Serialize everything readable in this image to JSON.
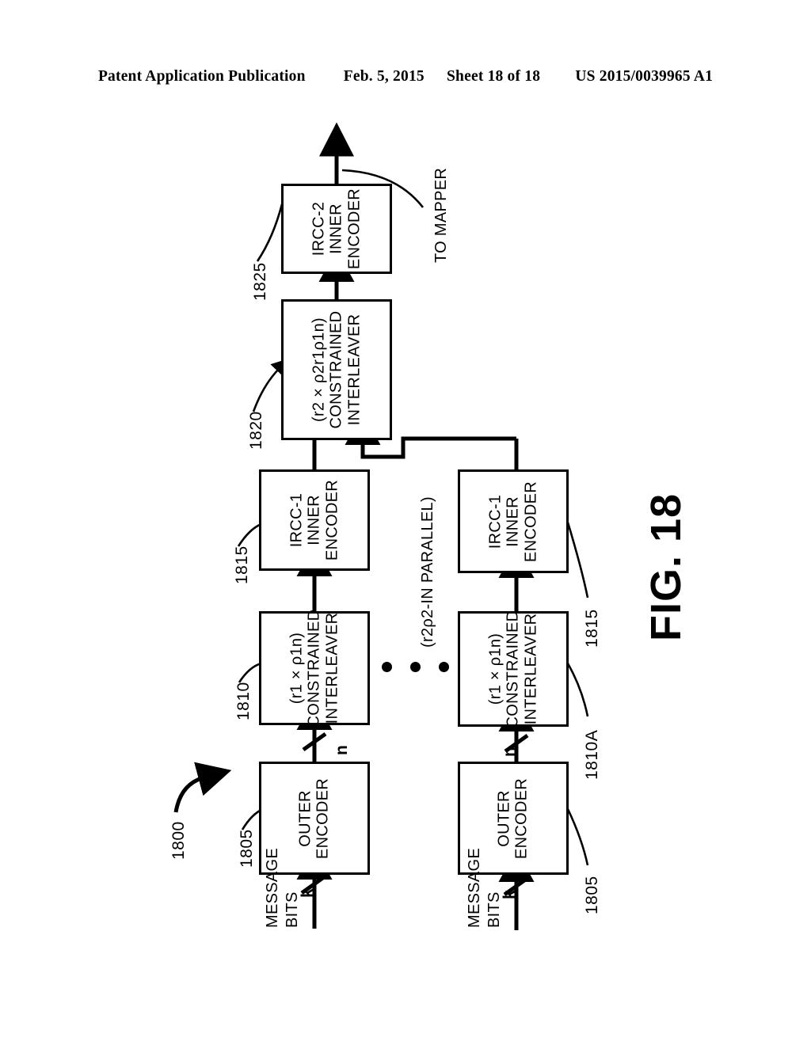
{
  "header": {
    "left": "Patent Application Publication",
    "date": "Feb. 5, 2015",
    "sheet": "Sheet 18 of 18",
    "patent_number": "US 2015/0039965 A1"
  },
  "figure": {
    "label": "FIG. 18",
    "system_ref": "1800",
    "output_label": "TO MAPPER",
    "parallel_note": "(r2ρ2-IN PARALLEL)",
    "ellipsis_dots": 3
  },
  "blocks": {
    "outer_encoder_top": {
      "line1": "OUTER",
      "line2": "ENCODER",
      "ref": "1805"
    },
    "interleaver_top": {
      "formula": "(r1  ×  ρ1n)",
      "line1": "CONSTRAINED",
      "line2": "INTERLEAVER",
      "ref": "1810"
    },
    "ircc1_top": {
      "line1": "IRCC-1",
      "line2": "INNER",
      "line3": "ENCODER",
      "ref": "1815"
    },
    "outer_encoder_bottom": {
      "line1": "OUTER",
      "line2": "ENCODER",
      "ref": "1805"
    },
    "interleaver_bottom": {
      "formula": "(r1  ×  ρ1n)",
      "line1": "CONSTRAINED",
      "line2": "INTERLEAVER",
      "ref": "1810A"
    },
    "ircc1_bottom": {
      "line1": "IRCC-1",
      "line2": "INNER",
      "line3": "ENCODER",
      "ref": "1815"
    },
    "interleaver_second_stage": {
      "formula": "(r2  ×  ρ2r1ρ1n)",
      "line1": "CONSTRAINED",
      "line2": "INTERLEAVER",
      "ref": "1820"
    },
    "ircc2": {
      "line1": "IRCC-2",
      "line2": "INNER",
      "line3": "ENCODER",
      "ref": "1825"
    }
  },
  "signals": {
    "message_bits_top": "MESSAGE\nBITS",
    "message_bits_top_l1": "MESSAGE",
    "message_bits_top_l2": "BITS",
    "message_bits_bottom_l1": "MESSAGE",
    "message_bits_bottom_l2": "BITS",
    "k_top": "k",
    "n_top": "n",
    "k_bottom": "k",
    "n_bottom": "n"
  },
  "colors": {
    "ink": "#000000",
    "paper": "#ffffff"
  }
}
